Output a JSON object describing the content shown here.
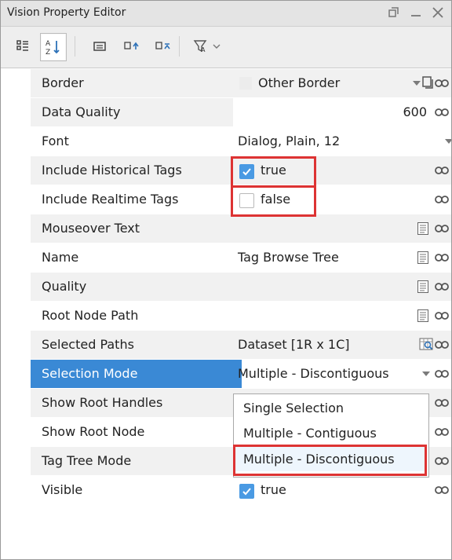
{
  "window": {
    "title": "Vision Property Editor"
  },
  "toolbar": {
    "buttons": [
      {
        "name": "categorize-button"
      },
      {
        "name": "sort-alphabetic-button"
      },
      {
        "name": "hide-descriptions-button"
      },
      {
        "name": "expand-all-button"
      },
      {
        "name": "collapse-all-button"
      },
      {
        "name": "filter-button"
      }
    ]
  },
  "properties": {
    "border": {
      "name": "Border",
      "value": "Other Border"
    },
    "data_quality": {
      "name": "Data Quality",
      "value": "600"
    },
    "font": {
      "name": "Font",
      "value": "Dialog, Plain, 12"
    },
    "include_historical_tags": {
      "name": "Include Historical Tags",
      "value": "true"
    },
    "include_realtime_tags": {
      "name": "Include Realtime Tags",
      "value": "false"
    },
    "mouseover_text": {
      "name": "Mouseover Text",
      "value": ""
    },
    "name": {
      "name": "Name",
      "value": "Tag Browse Tree"
    },
    "quality": {
      "name": "Quality",
      "value": ""
    },
    "root_node_path": {
      "name": "Root Node Path",
      "value": ""
    },
    "selected_paths": {
      "name": "Selected Paths",
      "value": "Dataset [1R x 1C]"
    },
    "selection_mode": {
      "name": "Selection Mode",
      "value": "Multiple - Discontiguous"
    },
    "show_root_handles": {
      "name": "Show Root Handles",
      "value": ""
    },
    "show_root_node": {
      "name": "Show Root Node",
      "value": ""
    },
    "tag_tree_mode": {
      "name": "Tag Tree Mode",
      "value": ""
    },
    "visible": {
      "name": "Visible",
      "value": "true"
    }
  },
  "dropdown": {
    "options": [
      "Single Selection",
      "Multiple - Contiguous",
      "Multiple - Discontiguous"
    ]
  },
  "colors": {
    "selection": "#3a89d5",
    "highlight_border": "#dd3333",
    "checkbox_checked": "#4a9ae3"
  }
}
